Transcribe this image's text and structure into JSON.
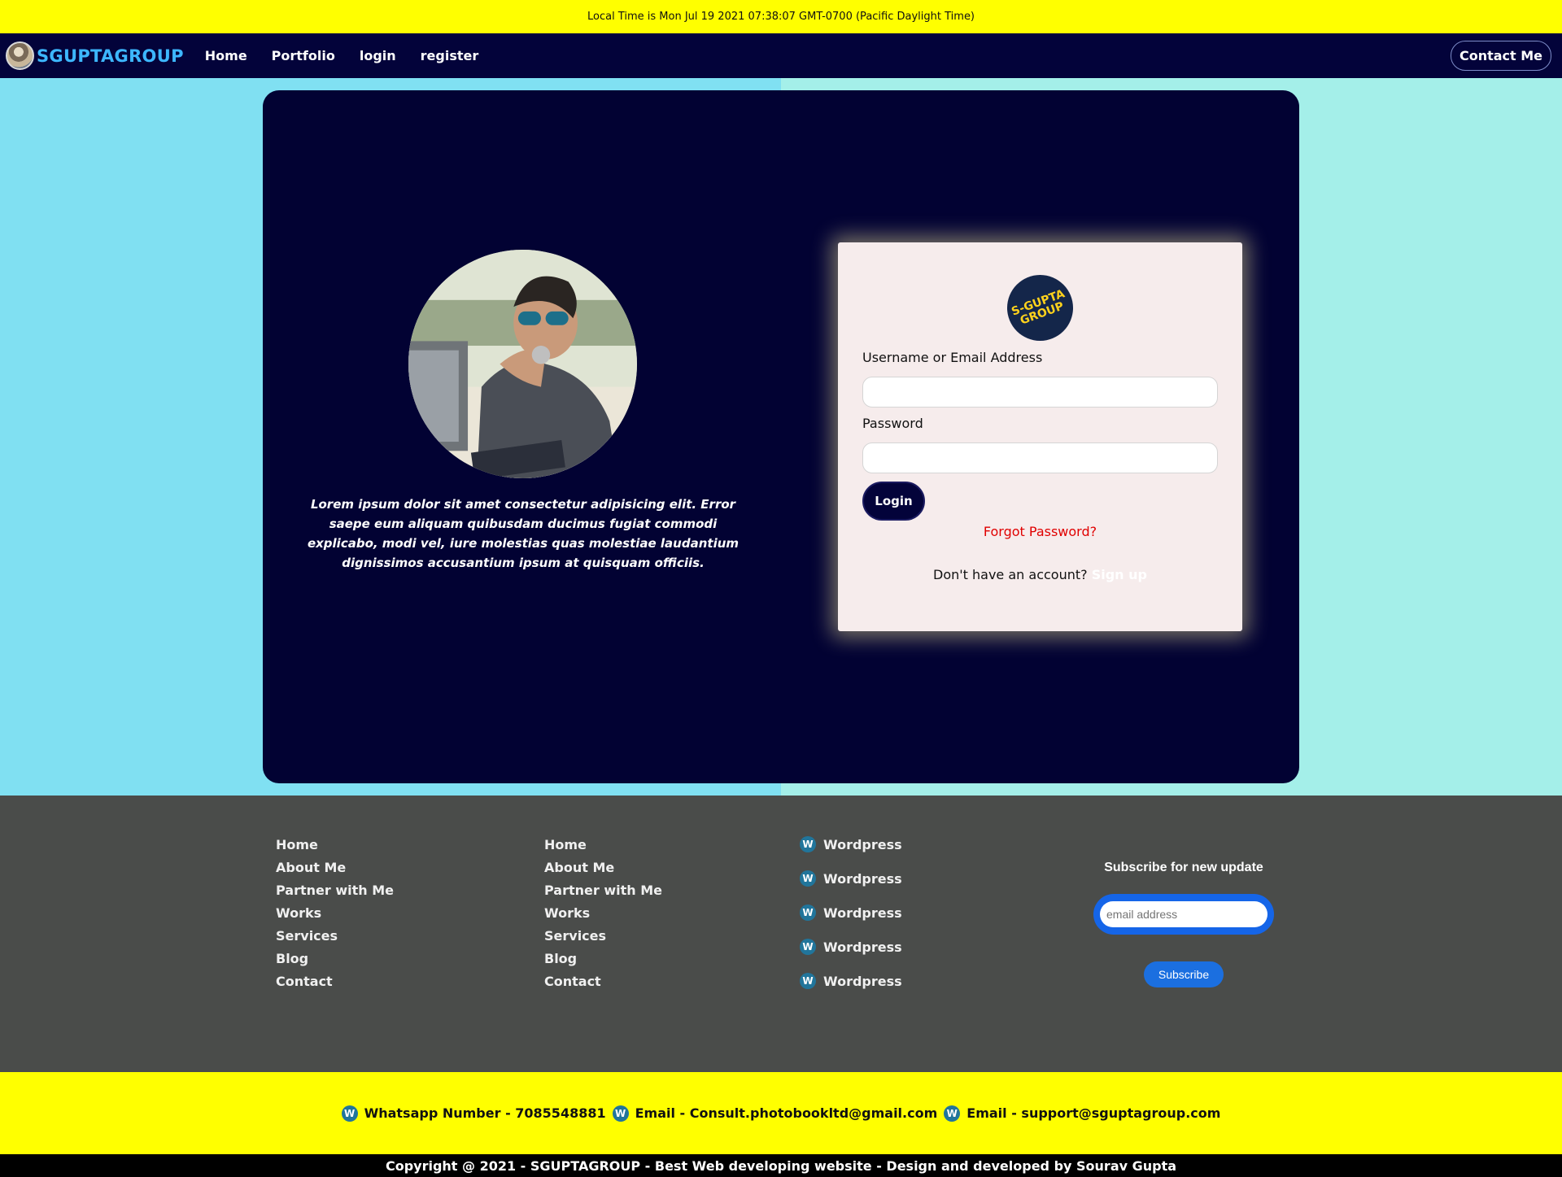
{
  "topbar": {
    "local_time": "Local Time is Mon Jul 19 2021 07:38:07 GMT-0700 (Pacific Daylight Time)"
  },
  "nav": {
    "brand": "SGUPTAGROUP",
    "links": [
      "Home",
      "Portfolio",
      "login",
      "register"
    ],
    "contact": "Contact Me"
  },
  "hero": {
    "bio": "Lorem ipsum dolor sit amet consectetur adipisicing elit. Error saepe eum aliquam quibusdam ducimus fugiat commodi explicabo, modi vel, iure molestias quas molestiae laudantium dignissimos accusantium ipsum at quisquam officiis."
  },
  "login": {
    "logo_text": "S-GUPTA GROUP",
    "username_label": "Username or Email Address",
    "username_value": "",
    "password_label": "Password",
    "password_value": "",
    "button": "Login",
    "forgot": "Forgot Password?",
    "no_account": "Don't have an account?",
    "signup": "Sign up"
  },
  "footer": {
    "col1": [
      "Home",
      "About Me",
      "Partner with Me",
      "Works",
      "Services",
      "Blog",
      "Contact"
    ],
    "col2": [
      "Home",
      "About Me",
      "Partner with Me",
      "Works",
      "Services",
      "Blog",
      "Contact"
    ],
    "col3": [
      "Wordpress",
      "Wordpress",
      "Wordpress",
      "Wordpress",
      "Wordpress"
    ],
    "subscribe_title": "Subscribe for new update",
    "email_placeholder": "email address",
    "subscribe_button": "Subscribe"
  },
  "contact_strip": {
    "whatsapp": "Whatsapp Number - 7085548881",
    "email1": "Email - Consult.photobookltd@gmail.com",
    "email2": "Email - support@sguptagroup.com"
  },
  "copyright": "Copyright @ 2021 - SGUPTAGROUP - Best Web developing website - Design and developed by Sourav Gupta",
  "colors": {
    "navbar": "#03033a",
    "brand": "#3db7ff",
    "topbar": "#ffff00",
    "footer": "#4a4c4a",
    "forgot": "#e00000",
    "subscribe": "#1565e8"
  },
  "icons": {
    "wordpress": "wordpress-icon"
  }
}
